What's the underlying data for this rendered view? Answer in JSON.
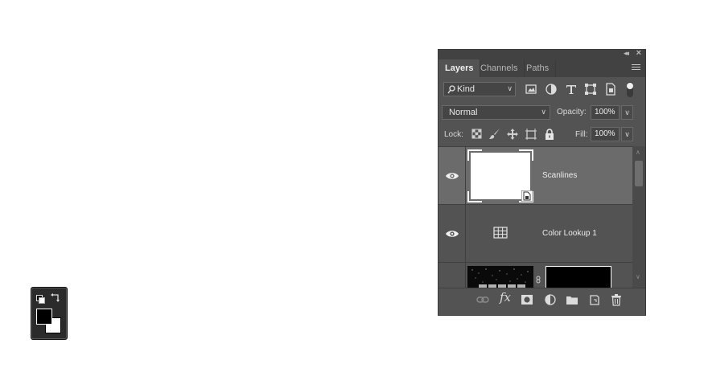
{
  "tools": {
    "foreground_color": "#000000",
    "background_color": "#ffffff",
    "icons": [
      "default-colors-icon",
      "swap-colors-icon"
    ]
  },
  "panel": {
    "tabs": [
      {
        "label": "Layers",
        "active": true
      },
      {
        "label": "Channels",
        "active": false
      },
      {
        "label": "Paths",
        "active": false
      }
    ],
    "filter": {
      "kind_label": "Kind",
      "icons": [
        "pixel-filter-icon",
        "adjustment-filter-icon",
        "type-filter-icon",
        "shape-filter-icon",
        "smart-object-filter-icon",
        "filter-toggle-icon"
      ]
    },
    "blend_mode": "Normal",
    "opacity_label": "Opacity:",
    "opacity_value": "100%",
    "lock_label": "Lock:",
    "lock_icons": [
      "lock-transparent-icon",
      "lock-image-icon",
      "lock-position-icon",
      "lock-artboard-icon",
      "lock-all-icon"
    ],
    "fill_label": "Fill:",
    "fill_value": "100%",
    "layers": [
      {
        "name": "Scanlines",
        "visible": true,
        "selected": true,
        "thumb": "smart-object-thumbnail"
      },
      {
        "name": "Color Lookup 1",
        "visible": true,
        "selected": false,
        "thumb": "color-lookup-icon"
      },
      {
        "name": "",
        "visible": false,
        "selected": false,
        "thumb": "text-layer-thumbnail"
      }
    ],
    "footer_icons": [
      "link-layers-icon",
      "fx-icon",
      "add-mask-icon",
      "new-adjustment-icon",
      "new-group-icon",
      "new-layer-icon",
      "delete-layer-icon"
    ],
    "fx_label": "fx",
    "colors": {
      "panel_bg": "#535353",
      "selected_row": "#6b6b6b",
      "tab_bar": "#424242"
    }
  }
}
